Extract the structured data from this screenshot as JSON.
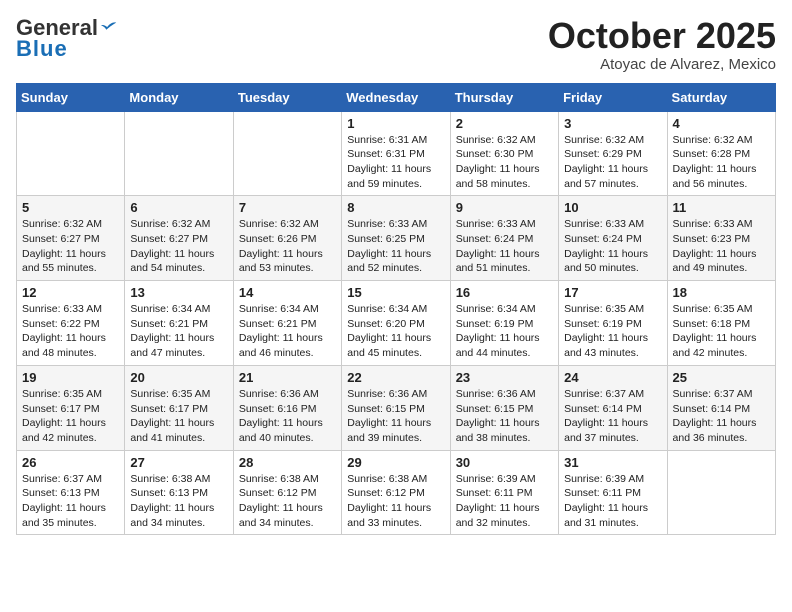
{
  "header": {
    "logo_line1": "General",
    "logo_line2": "Blue",
    "month": "October 2025",
    "location": "Atoyac de Alvarez, Mexico"
  },
  "weekdays": [
    "Sunday",
    "Monday",
    "Tuesday",
    "Wednesday",
    "Thursday",
    "Friday",
    "Saturday"
  ],
  "weeks": [
    [
      {
        "day": "",
        "info": ""
      },
      {
        "day": "",
        "info": ""
      },
      {
        "day": "",
        "info": ""
      },
      {
        "day": "1",
        "info": "Sunrise: 6:31 AM\nSunset: 6:31 PM\nDaylight: 11 hours and 59 minutes."
      },
      {
        "day": "2",
        "info": "Sunrise: 6:32 AM\nSunset: 6:30 PM\nDaylight: 11 hours and 58 minutes."
      },
      {
        "day": "3",
        "info": "Sunrise: 6:32 AM\nSunset: 6:29 PM\nDaylight: 11 hours and 57 minutes."
      },
      {
        "day": "4",
        "info": "Sunrise: 6:32 AM\nSunset: 6:28 PM\nDaylight: 11 hours and 56 minutes."
      }
    ],
    [
      {
        "day": "5",
        "info": "Sunrise: 6:32 AM\nSunset: 6:27 PM\nDaylight: 11 hours and 55 minutes."
      },
      {
        "day": "6",
        "info": "Sunrise: 6:32 AM\nSunset: 6:27 PM\nDaylight: 11 hours and 54 minutes."
      },
      {
        "day": "7",
        "info": "Sunrise: 6:32 AM\nSunset: 6:26 PM\nDaylight: 11 hours and 53 minutes."
      },
      {
        "day": "8",
        "info": "Sunrise: 6:33 AM\nSunset: 6:25 PM\nDaylight: 11 hours and 52 minutes."
      },
      {
        "day": "9",
        "info": "Sunrise: 6:33 AM\nSunset: 6:24 PM\nDaylight: 11 hours and 51 minutes."
      },
      {
        "day": "10",
        "info": "Sunrise: 6:33 AM\nSunset: 6:24 PM\nDaylight: 11 hours and 50 minutes."
      },
      {
        "day": "11",
        "info": "Sunrise: 6:33 AM\nSunset: 6:23 PM\nDaylight: 11 hours and 49 minutes."
      }
    ],
    [
      {
        "day": "12",
        "info": "Sunrise: 6:33 AM\nSunset: 6:22 PM\nDaylight: 11 hours and 48 minutes."
      },
      {
        "day": "13",
        "info": "Sunrise: 6:34 AM\nSunset: 6:21 PM\nDaylight: 11 hours and 47 minutes."
      },
      {
        "day": "14",
        "info": "Sunrise: 6:34 AM\nSunset: 6:21 PM\nDaylight: 11 hours and 46 minutes."
      },
      {
        "day": "15",
        "info": "Sunrise: 6:34 AM\nSunset: 6:20 PM\nDaylight: 11 hours and 45 minutes."
      },
      {
        "day": "16",
        "info": "Sunrise: 6:34 AM\nSunset: 6:19 PM\nDaylight: 11 hours and 44 minutes."
      },
      {
        "day": "17",
        "info": "Sunrise: 6:35 AM\nSunset: 6:19 PM\nDaylight: 11 hours and 43 minutes."
      },
      {
        "day": "18",
        "info": "Sunrise: 6:35 AM\nSunset: 6:18 PM\nDaylight: 11 hours and 42 minutes."
      }
    ],
    [
      {
        "day": "19",
        "info": "Sunrise: 6:35 AM\nSunset: 6:17 PM\nDaylight: 11 hours and 42 minutes."
      },
      {
        "day": "20",
        "info": "Sunrise: 6:35 AM\nSunset: 6:17 PM\nDaylight: 11 hours and 41 minutes."
      },
      {
        "day": "21",
        "info": "Sunrise: 6:36 AM\nSunset: 6:16 PM\nDaylight: 11 hours and 40 minutes."
      },
      {
        "day": "22",
        "info": "Sunrise: 6:36 AM\nSunset: 6:15 PM\nDaylight: 11 hours and 39 minutes."
      },
      {
        "day": "23",
        "info": "Sunrise: 6:36 AM\nSunset: 6:15 PM\nDaylight: 11 hours and 38 minutes."
      },
      {
        "day": "24",
        "info": "Sunrise: 6:37 AM\nSunset: 6:14 PM\nDaylight: 11 hours and 37 minutes."
      },
      {
        "day": "25",
        "info": "Sunrise: 6:37 AM\nSunset: 6:14 PM\nDaylight: 11 hours and 36 minutes."
      }
    ],
    [
      {
        "day": "26",
        "info": "Sunrise: 6:37 AM\nSunset: 6:13 PM\nDaylight: 11 hours and 35 minutes."
      },
      {
        "day": "27",
        "info": "Sunrise: 6:38 AM\nSunset: 6:13 PM\nDaylight: 11 hours and 34 minutes."
      },
      {
        "day": "28",
        "info": "Sunrise: 6:38 AM\nSunset: 6:12 PM\nDaylight: 11 hours and 34 minutes."
      },
      {
        "day": "29",
        "info": "Sunrise: 6:38 AM\nSunset: 6:12 PM\nDaylight: 11 hours and 33 minutes."
      },
      {
        "day": "30",
        "info": "Sunrise: 6:39 AM\nSunset: 6:11 PM\nDaylight: 11 hours and 32 minutes."
      },
      {
        "day": "31",
        "info": "Sunrise: 6:39 AM\nSunset: 6:11 PM\nDaylight: 11 hours and 31 minutes."
      },
      {
        "day": "",
        "info": ""
      }
    ]
  ]
}
